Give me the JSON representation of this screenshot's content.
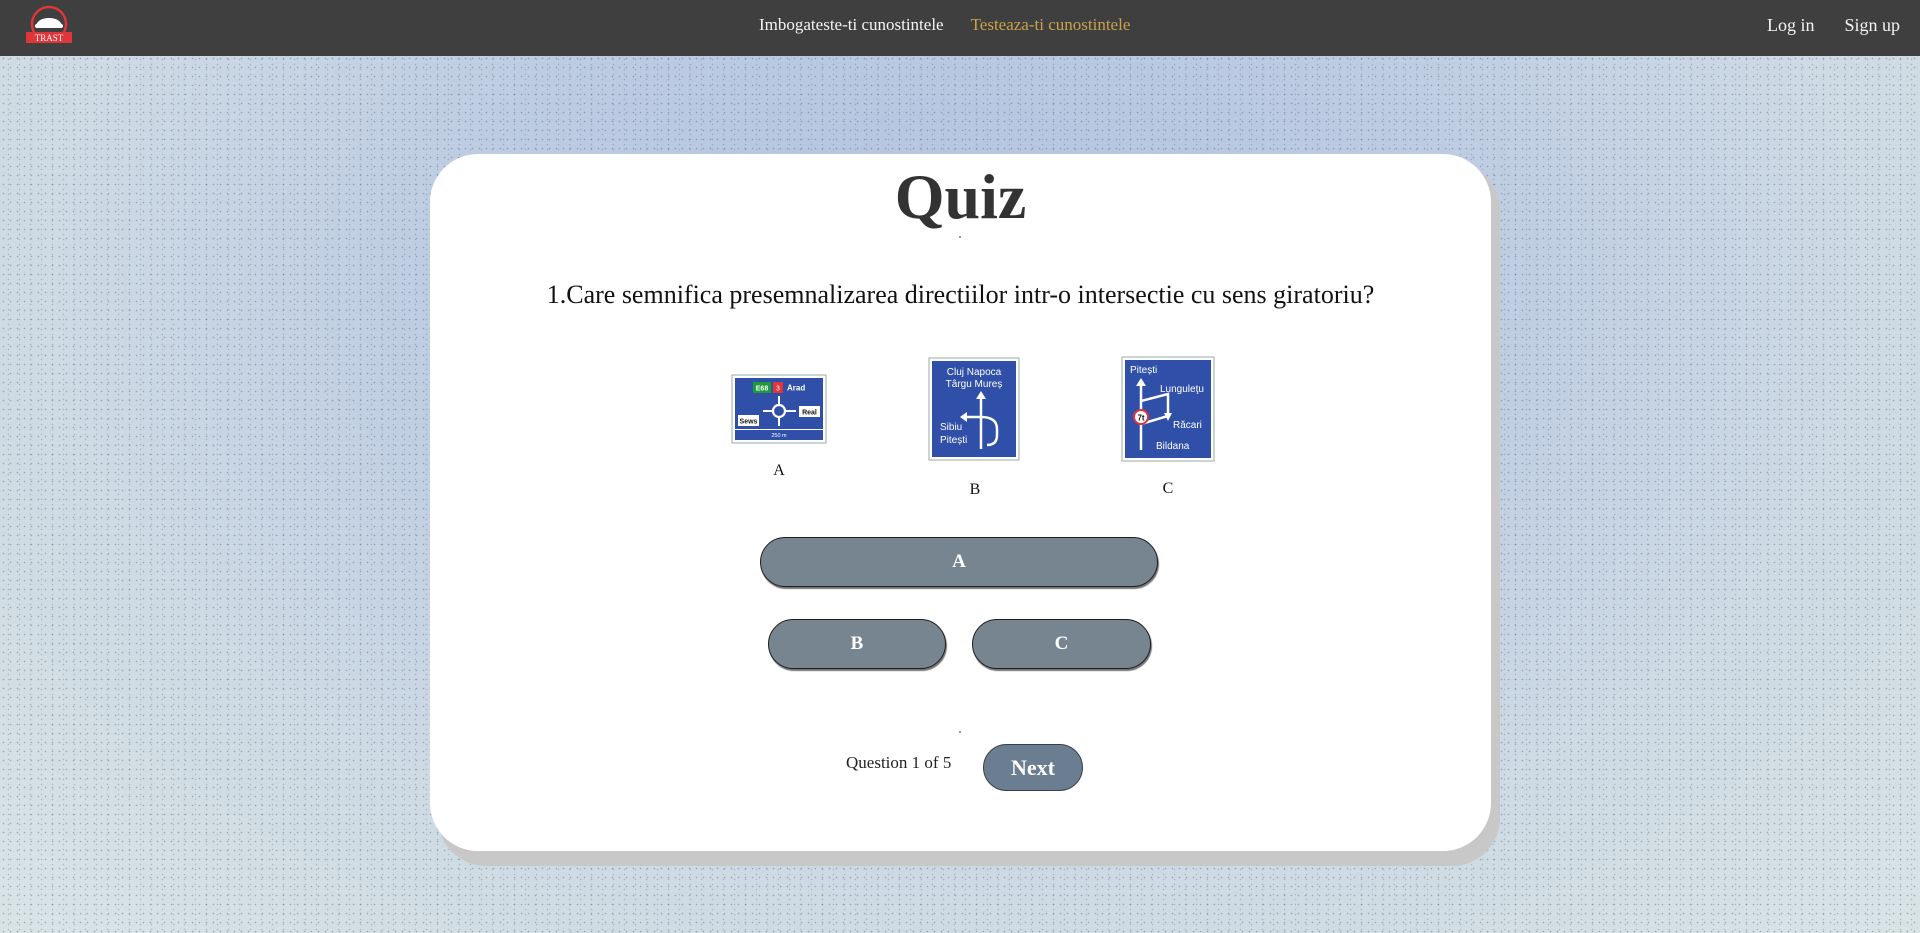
{
  "nav": {
    "logo_text": "TRAST",
    "links": [
      {
        "label": "Imbogateste-ti cunostintele",
        "active": false
      },
      {
        "label": "Testeaza-ti cunostintele",
        "active": true
      }
    ],
    "login_label": "Log in",
    "signup_label": "Sign up"
  },
  "quiz": {
    "title": "Quiz",
    "question": "1.Care semnifica presemnalizarea directiilor intr-o intersectie cu sens giratoriu?",
    "images": [
      {
        "caption": "A",
        "sign_text": [
          "E68",
          "3",
          "Arad",
          "Sews",
          "Real",
          "250 m"
        ]
      },
      {
        "caption": "B",
        "sign_text": [
          "Cluj Napoca",
          "Târgu Mureș",
          "Sibiu",
          "Pitești"
        ]
      },
      {
        "caption": "C",
        "sign_text": [
          "Pitești",
          "Lunguleţu",
          "7t",
          "Răcari",
          "Bildana"
        ]
      }
    ],
    "answers": [
      "A",
      "B",
      "C"
    ],
    "progress": {
      "prefix": "Question",
      "current": "1",
      "of": "of",
      "total": "5"
    },
    "next_label": "Next"
  },
  "colors": {
    "navbar": "#3f3f3f",
    "nav_active": "#c9a24b",
    "answer_button": "#778591",
    "next_button": "#6b7d91",
    "sign_blue": "#2f4fa8"
  }
}
